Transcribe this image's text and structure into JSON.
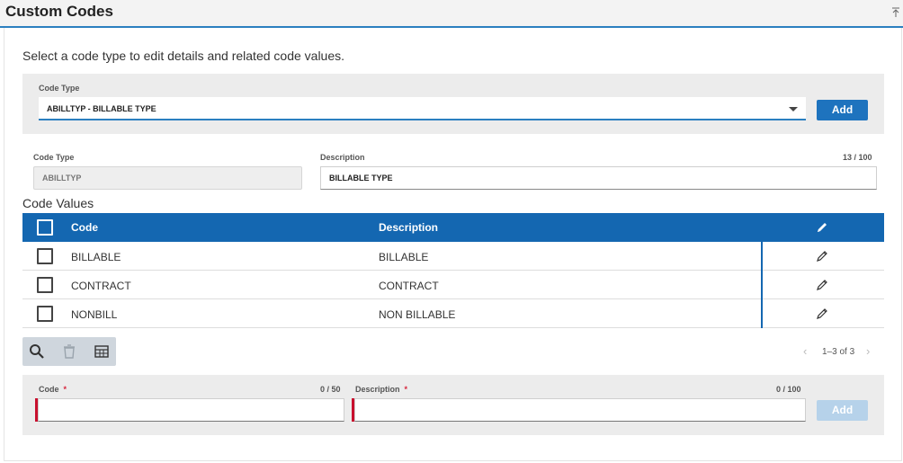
{
  "header": {
    "title": "Custom Codes",
    "collapse_icon": "collapse-up-icon"
  },
  "intro": "Select a code type to edit details and related code values.",
  "code_type_select": {
    "label": "Code Type",
    "value": "ABILLTYP - BILLABLE TYPE",
    "add_label": "Add"
  },
  "details": {
    "code_type_label": "Code Type",
    "code_type_value": "ABILLTYP",
    "description_label": "Description",
    "description_value": "BILLABLE TYPE",
    "description_counter": "13 / 100"
  },
  "code_values": {
    "title": "Code Values",
    "columns": [
      "Code",
      "Description"
    ],
    "rows": [
      {
        "code": "BILLABLE",
        "description": "BILLABLE"
      },
      {
        "code": "CONTRACT",
        "description": "CONTRACT"
      },
      {
        "code": "NONBILL",
        "description": "NON BILLABLE"
      }
    ]
  },
  "pager": {
    "text": "1–3 of 3",
    "prev": "‹",
    "next": "›"
  },
  "new_code": {
    "code_label": "Code",
    "code_counter": "0 / 50",
    "description_label": "Description",
    "description_counter": "0 / 100",
    "required_mark": "*",
    "add_label": "Add"
  },
  "colors": {
    "accent": "#1467b1",
    "button": "#1e73be",
    "required": "#c8102e"
  }
}
